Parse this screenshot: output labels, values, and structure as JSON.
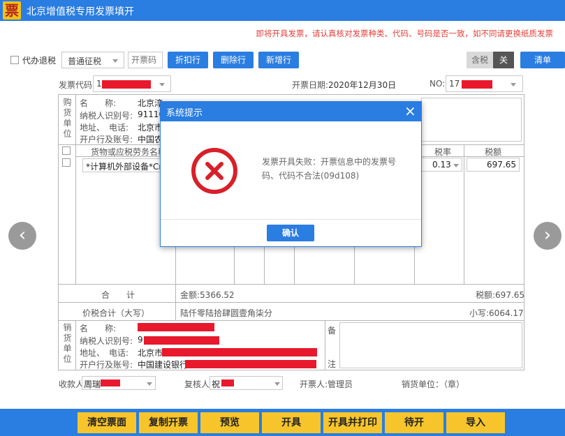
{
  "window": {
    "title": "北京增值税专用发票填开",
    "logo_char": "票"
  },
  "notice": "即将开具发票，请认真核对发票种类、代码、号码是否一致，如不同请更换纸质发票",
  "toolbar": {
    "proxy_refund_label": "代办退税",
    "tax_type_selected": "普通征税",
    "invoice_code_placeholder": "开票码",
    "discount_button": "折扣行",
    "delete_row_button": "删除行",
    "add_row_button": "新增行",
    "tax_included_label": "含税",
    "toggle_state": "关",
    "clear_button": "清单"
  },
  "header": {
    "code_label": "发票代码:",
    "code_value": "1",
    "date_label": "开票日期:",
    "date_value": "2020年12月30日",
    "no_label": "NO:",
    "no_value": "17"
  },
  "buyer": {
    "side_label": "购货单位",
    "name_label": "名　　称:",
    "name_value": "北京淳",
    "taxid_label": "纳税人识别号:",
    "taxid_value": "91110",
    "address_label": "地址、　电话:",
    "address_value": "北京市",
    "bank_label": "开户行及账号:",
    "bank_value": "中国农"
  },
  "items": {
    "col_goods": "货物或应税劳务名称",
    "col_rate": "税率",
    "col_tax": "税额",
    "rows": [
      {
        "name": "*计算机外部设备*Cro",
        "rate": "0.13",
        "tax": "697.65"
      }
    ]
  },
  "totals": {
    "sum_label": "合　　计",
    "amount": "金额:5366.52",
    "tax": "税额:697.65",
    "grand_label": "价税合计（大写）",
    "grand_words": "陆仟零陆拾肆圆壹角柒分",
    "grand_small": "小写:6064.17"
  },
  "seller": {
    "side_label": "销货单位",
    "name_label": "名　　称:",
    "taxid_label": "纳税人识别号:",
    "taxid_value": "9",
    "address_label": "地址、　电话:",
    "address_value": "北京市",
    "bank_label": "开户行及账号:",
    "bank_value": "中国建设银行北",
    "remark_label": "备",
    "remark_label2": "注"
  },
  "footer": {
    "payee_label": "收款人:",
    "payee_value": "周瑞",
    "reviewer_label": "复核人:",
    "reviewer_value": "祝",
    "drawer_label": "开票人:管理员",
    "seller_unit_label": "销货单位：（章）"
  },
  "bottom_buttons": [
    "清空票面",
    "复制开票",
    "预览",
    "开具",
    "开具并打印",
    "待开",
    "导入"
  ],
  "dialog": {
    "title": "系统提示",
    "message": "发票开具失败：开票信息中的发票号码、代码不合法(09d108)",
    "confirm": "确认"
  },
  "colors": {
    "accent": "#2a7de1",
    "error": "#e2403a",
    "button_yellow": "#f7c52b"
  }
}
